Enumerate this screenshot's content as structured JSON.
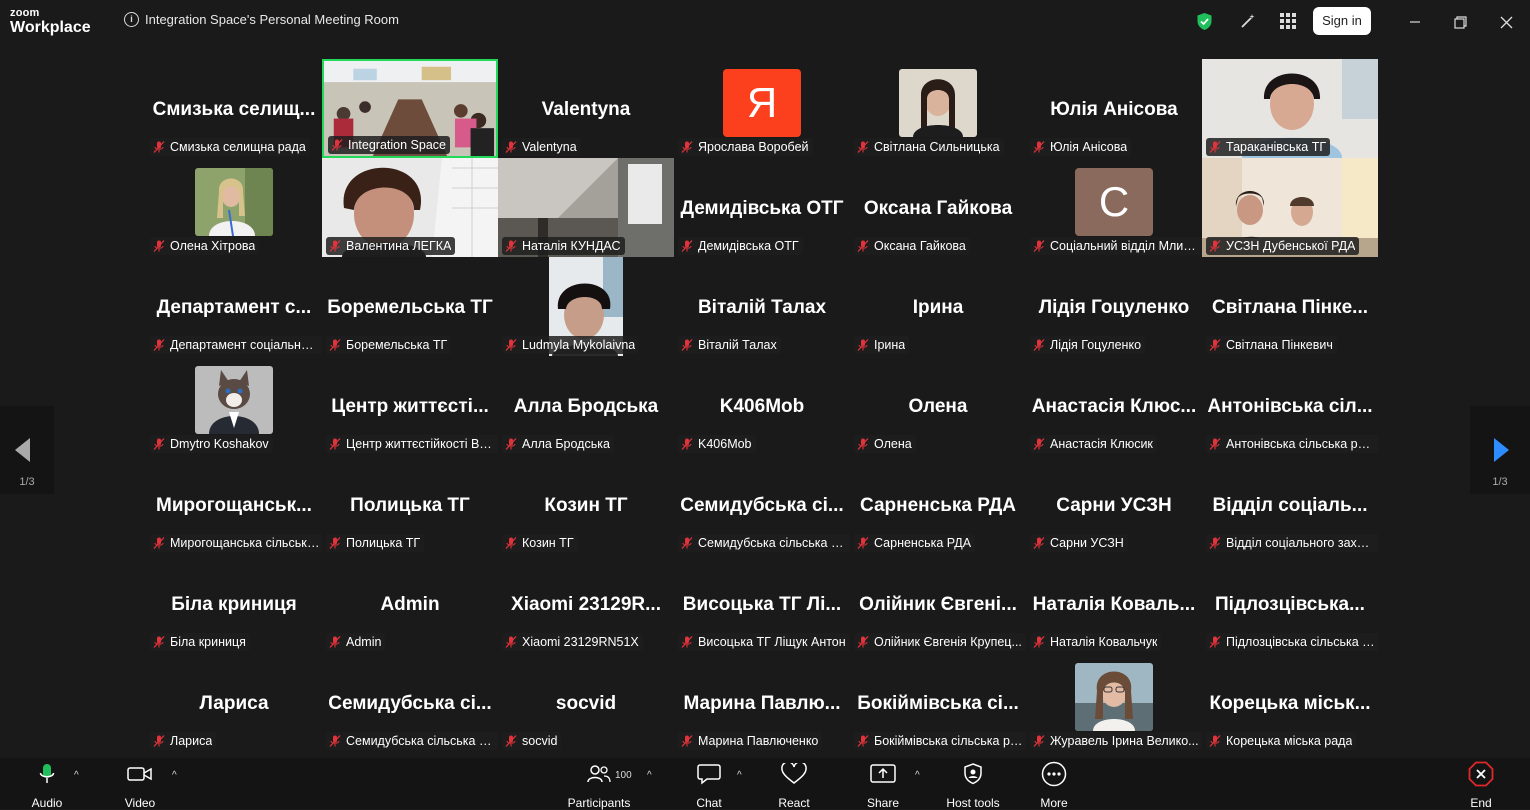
{
  "app": {
    "logo_top": "zoom",
    "logo_bottom": "Workplace",
    "meeting_title": "Integration Space's Personal Meeting Room",
    "signin_label": "Sign in"
  },
  "colors": {
    "active_border": "#23d959",
    "avatar_ya": "#fc3f1d",
    "avatar_c": "#8a6a5c",
    "shield": "#1fbf5b",
    "end_red": "#e02828"
  },
  "pager": {
    "left_label": "1/3",
    "right_label": "1/3"
  },
  "tiles": [
    {
      "name": "Смизька селищ...",
      "label": "Смизька селищна рада"
    },
    {
      "name": "",
      "label": "Integration Space",
      "active": true,
      "photo": "room"
    },
    {
      "name": "Valentyna",
      "label": "Valentyna"
    },
    {
      "name": "",
      "label": "Ярослава Воробей",
      "avatar_letter": "Я"
    },
    {
      "name": "",
      "label": "Світлана Сильницька",
      "photo": "woman-small"
    },
    {
      "name": "Юлія Анісова",
      "label": "Юлія Анісова"
    },
    {
      "name": "",
      "label": "Тараканівська ТГ",
      "photo": "woman-large"
    },
    {
      "name": "",
      "label": "Олена Хітрова",
      "photo": "blonde-small"
    },
    {
      "name": "",
      "label": "Валентина ЛЕГКА",
      "photo": "face-large"
    },
    {
      "name": "",
      "label": "Наталія КУНДАС",
      "photo": "room-ceiling"
    },
    {
      "name": "Демидівська ОТГ",
      "label": "Демидівська ОТГ"
    },
    {
      "name": "Оксана Гайкова",
      "label": "Оксана Гайкова"
    },
    {
      "name": "",
      "label": "Соціальний відділ Млині...",
      "avatar_letter": "C"
    },
    {
      "name": "",
      "label": "УСЗН Дубенської РДА",
      "photo": "office"
    },
    {
      "name": "Департамент с...",
      "label": "Департамент соціальної ..."
    },
    {
      "name": "Боремельська ТГ",
      "label": "Боремельська ТГ"
    },
    {
      "name": "",
      "label": "Ludmyla Mykolaivna",
      "photo": "woman-dark"
    },
    {
      "name": "Віталій Талах",
      "label": "Віталій Талах"
    },
    {
      "name": "Ірина",
      "label": "Ірина"
    },
    {
      "name": "Лідія Гоцуленко",
      "label": "Лідія Гоцуленко"
    },
    {
      "name": "Світлана Пінке...",
      "label": "Світлана Пінкевич"
    },
    {
      "name": "",
      "label": "Dmytro Koshakov",
      "photo": "cat"
    },
    {
      "name": "Центр життєсті...",
      "label": "Центр життєстійкості Ви..."
    },
    {
      "name": "Алла Бродська",
      "label": "Алла Бродська"
    },
    {
      "name": "K406Mob",
      "label": "K406Mob"
    },
    {
      "name": "Олена",
      "label": "Олена"
    },
    {
      "name": "Анастасія Клюс...",
      "label": "Анастасія Клюсик"
    },
    {
      "name": "Антонівська сіл...",
      "label": "Антонівська сільська рада"
    },
    {
      "name": "Мирогощанськ...",
      "label": "Мирогощанська сільська..."
    },
    {
      "name": "Полицька ТГ",
      "label": "Полицька ТГ"
    },
    {
      "name": "Козин ТГ",
      "label": "Козин ТГ"
    },
    {
      "name": "Семидубська сі...",
      "label": "Семидубська сільська ра..."
    },
    {
      "name": "Сарненська РДА",
      "label": "Сарненська РДА"
    },
    {
      "name": "Сарни УСЗН",
      "label": "Сарни УСЗН"
    },
    {
      "name": "Відділ соціаль...",
      "label": "Відділ соціального захис..."
    },
    {
      "name": "Біла криниця",
      "label": "Біла криниця"
    },
    {
      "name": "Admin",
      "label": "Admin"
    },
    {
      "name": "Xiaomi 23129R...",
      "label": "Xiaomi 23129RN51X"
    },
    {
      "name": "Висоцька ТГ Лі...",
      "label": "Висоцька ТГ Ліщук Антон"
    },
    {
      "name": "Олійник Євгені...",
      "label": "Олійник Євгенія Крупец..."
    },
    {
      "name": "Наталія Коваль...",
      "label": "Наталія Ковальчук"
    },
    {
      "name": "Підлозцівська...",
      "label": "Підлозцівська сільська р..."
    },
    {
      "name": "Лариса",
      "label": "Лариса"
    },
    {
      "name": "Семидубська сі...",
      "label": "Семидубська сільська ра..."
    },
    {
      "name": "socvid",
      "label": "socvid"
    },
    {
      "name": "Марина Павлю...",
      "label": "Марина Павлюченко"
    },
    {
      "name": "Бокіймівська сі...",
      "label": "Бокіймівська сільська ра..."
    },
    {
      "name": "",
      "label": "Журавель Ірина Велико...",
      "photo": "woman-glasses"
    },
    {
      "name": "Корецька міськ...",
      "label": "Корецька міська рада"
    }
  ],
  "toolbar": {
    "audio": "Audio",
    "video": "Video",
    "participants": "Participants",
    "participants_count": "100",
    "chat": "Chat",
    "react": "React",
    "share": "Share",
    "host_tools": "Host tools",
    "more": "More",
    "end": "End"
  }
}
